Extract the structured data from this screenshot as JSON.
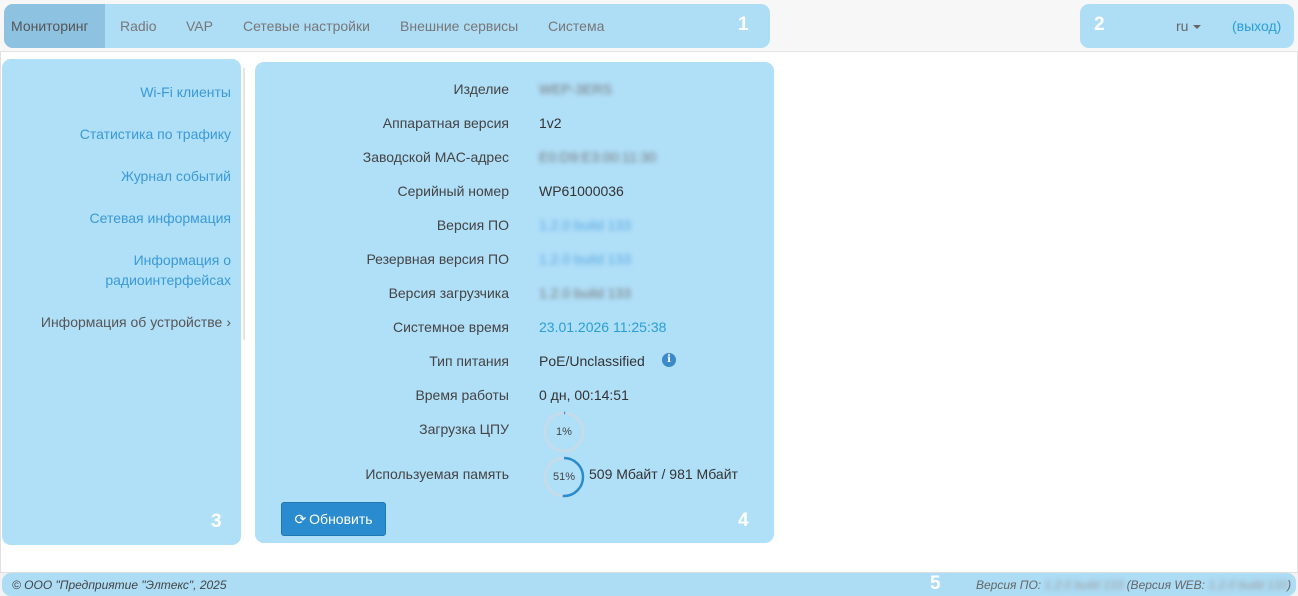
{
  "nav": {
    "tabs": [
      {
        "label": "Мониторинг",
        "active": true
      },
      {
        "label": "Radio"
      },
      {
        "label": "VAP"
      },
      {
        "label": "Сетевые настройки"
      },
      {
        "label": "Внешние сервисы"
      },
      {
        "label": "Система"
      }
    ],
    "lang": "ru",
    "logout": "(выход)"
  },
  "sidebar": {
    "items": [
      {
        "label": "Wi-Fi клиенты"
      },
      {
        "label": "Статистика по трафику"
      },
      {
        "label": "Журнал событий"
      },
      {
        "label": "Сетевая информация"
      },
      {
        "label": "Информация о радиоинтерфейсах"
      },
      {
        "label": "Информация об устройстве",
        "active": true
      }
    ]
  },
  "device_info": {
    "rows": [
      {
        "label": "Изделие",
        "value": "WEP-3ERS"
      },
      {
        "label": "Аппаратная версия",
        "value": "1v2"
      },
      {
        "label": "Заводской MAC-адрес",
        "value": "E0:D9:E3:00:11:30"
      },
      {
        "label": "Серийный номер",
        "value": "WP61000036"
      },
      {
        "label": "Версия ПО",
        "value": "1.2.0 build 133"
      },
      {
        "label": "Резервная версия ПО",
        "value": "1.2.0 build 133"
      },
      {
        "label": "Версия загрузчика",
        "value": "1.2.0 build 133"
      },
      {
        "label": "Системное время",
        "value": "23.01.2026 11:25:38"
      },
      {
        "label": "Тип питания",
        "value": "PoE/Unclassified"
      },
      {
        "label": "Время работы",
        "value": "0 дн, 00:14:51"
      },
      {
        "label": "Загрузка ЦПУ",
        "value": "1%"
      },
      {
        "label": "Используемая память",
        "value": "51%",
        "detail": "509 Мбайт / 981 Мбайт"
      }
    ],
    "cpu_load": 0.01,
    "memory_used": 0.51,
    "refresh_button": "Обновить"
  },
  "footer": {
    "copyright": "© ООО \"Предприятие \"Элтекс\", 2025",
    "fw_prefix": "Версия ПО:",
    "fw_value": "1.2.0 build 133",
    "web_prefix": "(Версия WEB:",
    "web_value": "1.2.0 build 133",
    "web_suffix": ")"
  },
  "annotations": [
    "1",
    "2",
    "3",
    "4",
    "5"
  ],
  "colors": {
    "accent": "#2a9fd6",
    "highlight_zone": "#96d4f5",
    "button": "#2a8ccf",
    "gauge_ring": "#2a8ccf",
    "gauge_track": "#c9dbe6"
  }
}
